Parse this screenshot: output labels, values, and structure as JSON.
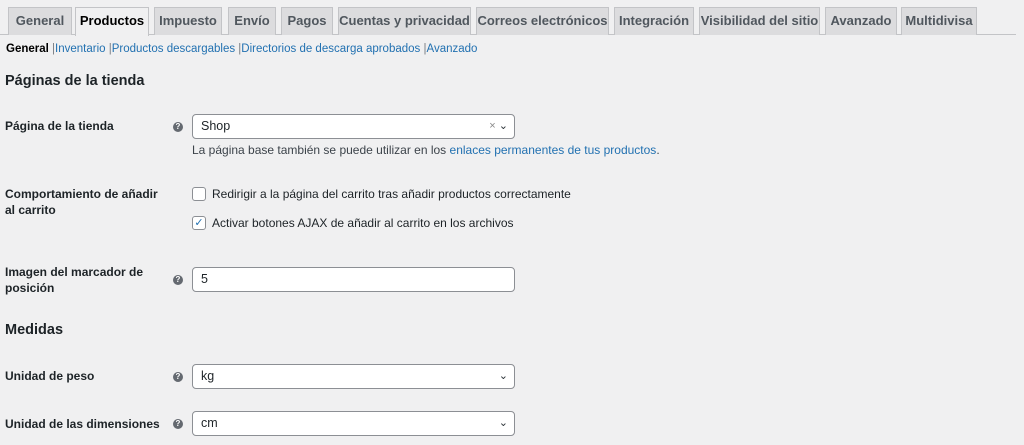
{
  "tabs": [
    "General",
    "Productos",
    "Impuesto",
    "Envío",
    "Pagos",
    "Cuentas y privacidad",
    "Correos electrónicos",
    "Integración",
    "Visibilidad del sitio",
    "Avanzado",
    "Multidivisa"
  ],
  "active_tab": "Productos",
  "subnav": {
    "current": "General",
    "links": [
      "Inventario",
      "Productos descargables",
      "Directorios de descarga aprobados",
      "Avanzado"
    ]
  },
  "sections": {
    "shop_pages": "Páginas de la tienda",
    "measures": "Medidas"
  },
  "shop_page": {
    "label": "Página de la tienda",
    "value": "Shop",
    "desc_prefix": "La página base también se puede utilizar en los ",
    "desc_link": "enlaces permanentes de tus productos",
    "desc_suffix": "."
  },
  "add_to_cart": {
    "label": "Comportamiento de añadir al carrito",
    "options": [
      {
        "label": "Redirigir a la página del carrito tras añadir productos correctamente",
        "checked": false
      },
      {
        "label": "Activar botones AJAX de añadir al carrito en los archivos",
        "checked": true
      }
    ]
  },
  "placeholder": {
    "label": "Imagen del marcador de posición",
    "value": "5"
  },
  "weight": {
    "label": "Unidad de peso",
    "value": "kg"
  },
  "dimensions": {
    "label": "Unidad de las dimensiones",
    "value": "cm"
  }
}
